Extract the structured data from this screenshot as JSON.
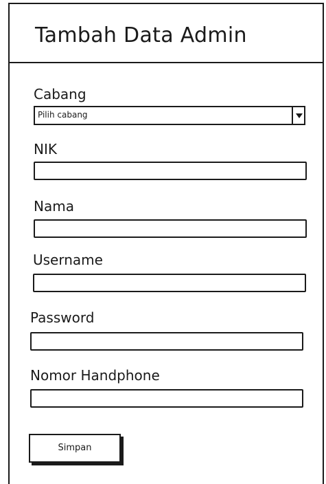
{
  "page": {
    "title": "Tambah Data Admin"
  },
  "form": {
    "cabang": {
      "label": "Cabang",
      "selected": "Pilih cabang"
    },
    "nik": {
      "label": "NIK",
      "value": ""
    },
    "nama": {
      "label": "Nama",
      "value": ""
    },
    "username": {
      "label": "Username",
      "value": ""
    },
    "password": {
      "label": "Password",
      "value": ""
    },
    "nomor_handphone": {
      "label": "Nomor Handphone",
      "value": ""
    },
    "submit_label": "Simpan"
  },
  "icons": {
    "dropdown": "chevron-down-icon"
  },
  "colors": {
    "stroke": "#1a1a1a",
    "background": "#ffffff"
  }
}
